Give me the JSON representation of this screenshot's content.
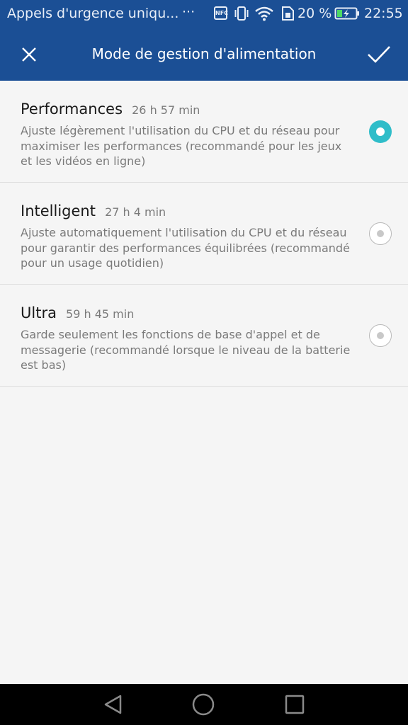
{
  "status_bar": {
    "notification_text": "Appels d'urgence uniqu...",
    "overflow": "···",
    "nfc": "NFC",
    "battery_percent": "20 %",
    "time": "22:55"
  },
  "toolbar": {
    "title": "Mode de gestion d'alimentation"
  },
  "options": [
    {
      "name": "Performances",
      "time": "26 h  57 min",
      "description": "Ajuste légèrement l'utilisation du CPU et du réseau pour maximiser les performances (recommandé pour les jeux et les vidéos en ligne)",
      "selected": true
    },
    {
      "name": "Intelligent",
      "time": "27 h  4 min",
      "description": "Ajuste automatiquement l'utilisation du CPU et du réseau pour garantir des performances équilibrées (recommandé pour un usage quotidien)",
      "selected": false
    },
    {
      "name": "Ultra",
      "time": "59 h  45 min",
      "description": "Garde seulement les fonctions de base d'appel et de messagerie (recommandé lorsque le niveau de la batterie est bas)",
      "selected": false
    }
  ],
  "colors": {
    "header": "#1b4f95",
    "accent": "#2fbdc9",
    "background": "#f5f5f5"
  }
}
